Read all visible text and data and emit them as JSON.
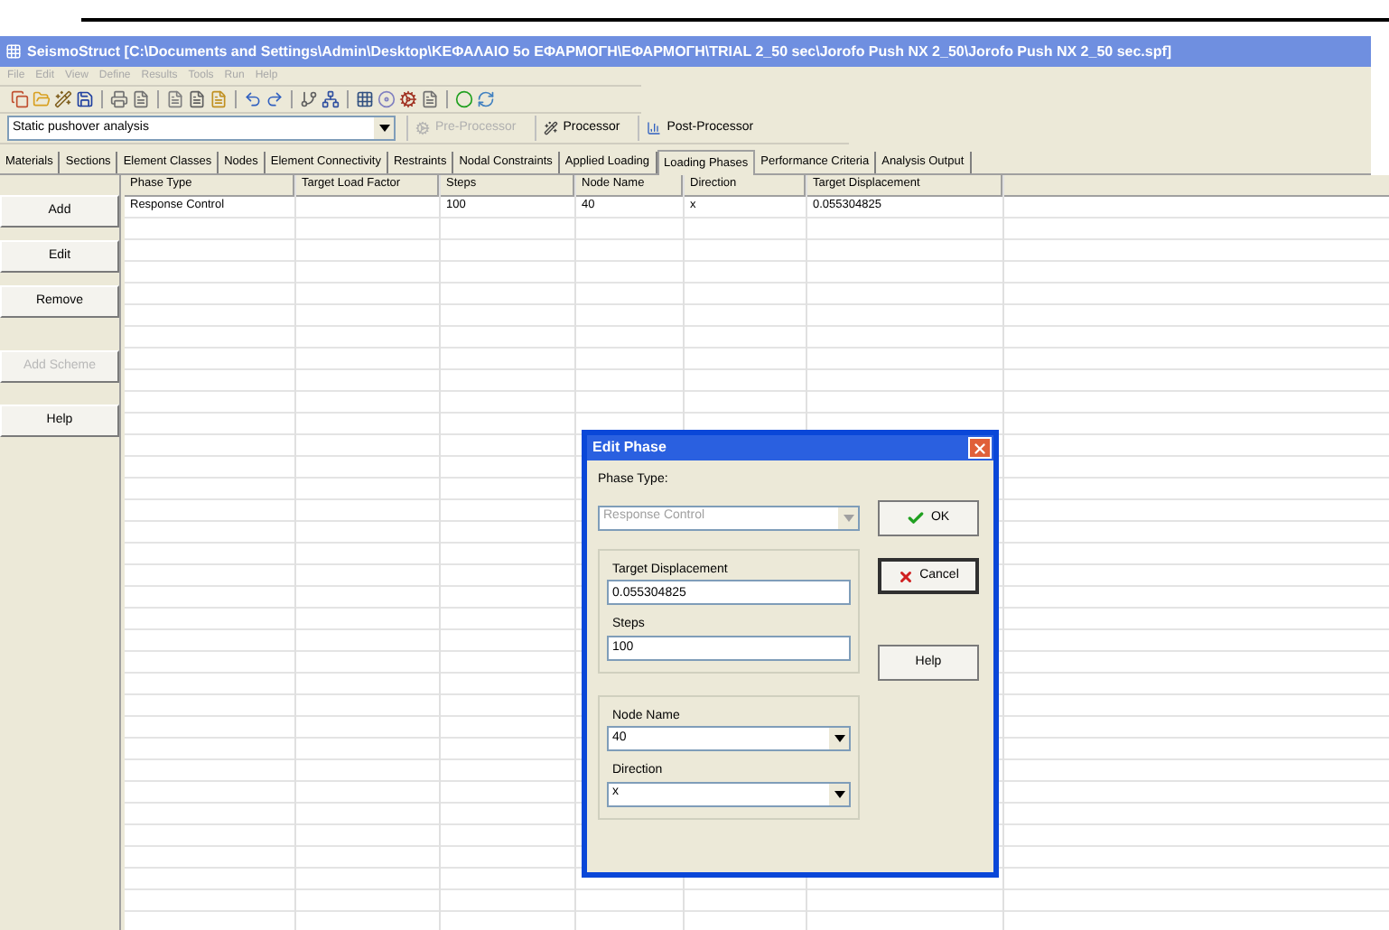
{
  "window": {
    "title": "SeismoStruct  [C:\\Documents and Settings\\Admin\\Desktop\\ΚΕΦΑΛΑΙΟ 5ο ΕΦΑΡΜΟΓΗ\\ΕΦΑΡΜΟΓΗ\\TRIAL 2_50 sec\\Jorofo Push NX 2_50\\Jorofo Push NX 2_50 sec.spf]"
  },
  "menu": [
    "File",
    "Edit",
    "View",
    "Define",
    "Results",
    "Tools",
    "Run",
    "Help"
  ],
  "analysis_type": "Static pushover analysis",
  "processor_buttons": [
    {
      "label": "Pre-Processor",
      "disabled": true
    },
    {
      "label": "Processor",
      "disabled": false
    },
    {
      "label": "Post-Processor",
      "disabled": false
    }
  ],
  "tabs": [
    {
      "label": "Materials",
      "selected": false
    },
    {
      "label": "Sections",
      "selected": false
    },
    {
      "label": "Element Classes",
      "selected": false
    },
    {
      "label": "Nodes",
      "selected": false
    },
    {
      "label": "Element Connectivity",
      "selected": false
    },
    {
      "label": "Restraints",
      "selected": false
    },
    {
      "label": "Nodal Constraints",
      "selected": false
    },
    {
      "label": "Applied Loading",
      "selected": false
    },
    {
      "label": "Loading Phases",
      "selected": true
    },
    {
      "label": "Performance Criteria",
      "selected": false
    },
    {
      "label": "Analysis Output",
      "selected": false
    }
  ],
  "side_buttons": [
    {
      "label": "Add",
      "disabled": false
    },
    {
      "label": "Edit",
      "disabled": false
    },
    {
      "label": "Remove",
      "disabled": false
    },
    {
      "label": "Add Scheme",
      "disabled": true
    },
    {
      "label": "Help",
      "disabled": false
    }
  ],
  "table": {
    "columns": [
      "Phase Type",
      "Target Load Factor",
      "Steps",
      "Node Name",
      "Direction",
      "Target Displacement"
    ],
    "rows": [
      [
        "Response Control",
        "",
        "100",
        "40",
        "x",
        "0.055304825"
      ]
    ]
  },
  "dialog": {
    "title": "Edit Phase",
    "phase_type_label": "Phase Type:",
    "phase_type": {
      "value": "Response Control",
      "disabled": true
    },
    "fields": [
      {
        "label": "Target Displacement",
        "value": "0.055304825",
        "kind": "text"
      },
      {
        "label": "Steps",
        "value": "100",
        "kind": "text"
      },
      {
        "label": "Node Name",
        "value": "40",
        "kind": "dropdown"
      },
      {
        "label": "Direction",
        "value": "x",
        "kind": "dropdown"
      }
    ],
    "buttons": [
      {
        "label": "OK",
        "kind": "ok",
        "focused": false
      },
      {
        "label": "Cancel",
        "kind": "cancel",
        "focused": true
      },
      {
        "label": "Help",
        "kind": "help",
        "focused": false
      }
    ]
  }
}
